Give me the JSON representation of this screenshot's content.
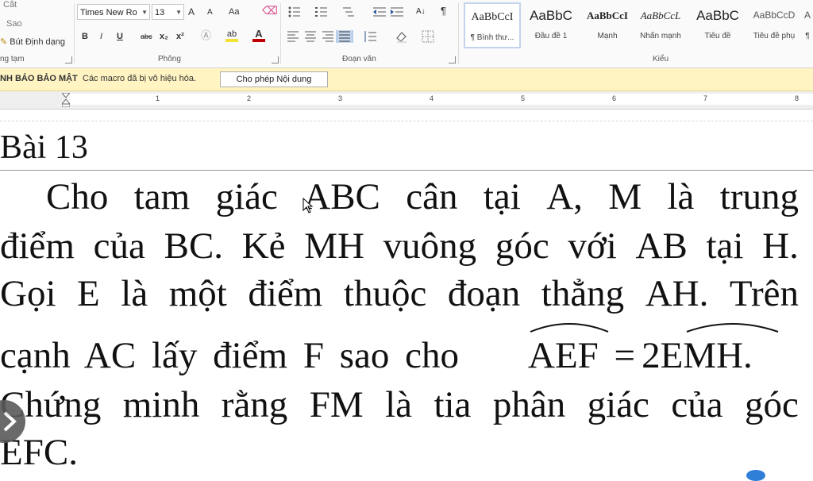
{
  "ribbon": {
    "clipboard": {
      "cut": "Cắt",
      "copy": "Sao",
      "format_painter": "Bút Định dạng",
      "label": "ng tạm"
    },
    "font": {
      "name": "Times New Ro",
      "size": "13",
      "grow": "A",
      "shrink": "A",
      "case": "Aa",
      "bold": "B",
      "italic": "I",
      "underline": "U",
      "strike": "abc",
      "subscript": "x₂",
      "superscript": "x²",
      "label": "Phông"
    },
    "paragraph": {
      "sort": "A↓",
      "show_marks": "¶",
      "label": "Đoạn văn"
    },
    "styles": {
      "label": "Kiểu",
      "items": [
        {
          "preview": "AaBbCcI",
          "name": "¶ Bình thư..."
        },
        {
          "preview": "AaBbC",
          "name": "Đầu đề 1"
        },
        {
          "preview": "AaBbCcI",
          "name": "Mạnh"
        },
        {
          "preview": "AaBbCcL",
          "name": "Nhấn mạnh"
        },
        {
          "preview": "AaBbC",
          "name": "Tiêu đề"
        },
        {
          "preview": "AaBbCcD",
          "name": "Tiêu đề phụ"
        },
        {
          "preview": "A",
          "name": "¶"
        }
      ]
    }
  },
  "security_bar": {
    "title": "NH BÁO BẢO MẬT",
    "message": "Các macro đã bị vô hiệu hóa.",
    "button": "Cho phép Nội dung"
  },
  "ruler": {
    "numbers": [
      "1",
      "2",
      "3",
      "4",
      "5",
      "6",
      "7",
      "8"
    ]
  },
  "document": {
    "heading": "Bài 13",
    "lines": [
      {
        "words": [
          "Cho",
          "tam",
          "giác",
          "ABC",
          "cân",
          "tại",
          "A,",
          "M",
          "là",
          "trung"
        ]
      },
      {
        "words": [
          "điểm",
          "của",
          "BC.",
          "Kẻ",
          "MH",
          "vuông",
          "góc",
          "với",
          "AB",
          "tại",
          "H."
        ]
      },
      {
        "words": [
          "Gọi",
          "E",
          "là",
          "một",
          "điểm",
          "thuộc",
          "đoạn",
          "thẳng",
          "AH.",
          "Trên"
        ]
      },
      {
        "words": [
          "cạnh",
          "AC",
          "lấy",
          "điểm",
          "F",
          "sao",
          "cho"
        ]
      },
      {
        "words": [
          "Chứng",
          "minh",
          "rằng",
          "FM",
          "là",
          "tia",
          "phân",
          "giác",
          "của",
          "góc"
        ]
      },
      {
        "words": [
          "EFC."
        ]
      }
    ],
    "equation": {
      "left": "AEF",
      "op": "=",
      "coef": "2",
      "right": "EMH",
      "end": "."
    }
  },
  "colors": {
    "accent": "#2b579a",
    "security_bg": "#fff4c2",
    "highlight_red": "#c00000",
    "highlight_yellow": "#f2e233"
  },
  "icons": [
    "bullets-icon",
    "numbering-icon",
    "multilevel-list-icon",
    "decrease-indent-icon",
    "increase-indent-icon",
    "sort-icon",
    "show-marks-icon",
    "align-left-icon",
    "align-center-icon",
    "align-right-icon",
    "justify-icon",
    "line-spacing-icon",
    "shading-icon",
    "borders-icon",
    "eraser-icon",
    "text-effects-icon",
    "highlight-icon",
    "font-color-icon",
    "play-icon",
    "mouse-cursor-icon"
  ]
}
